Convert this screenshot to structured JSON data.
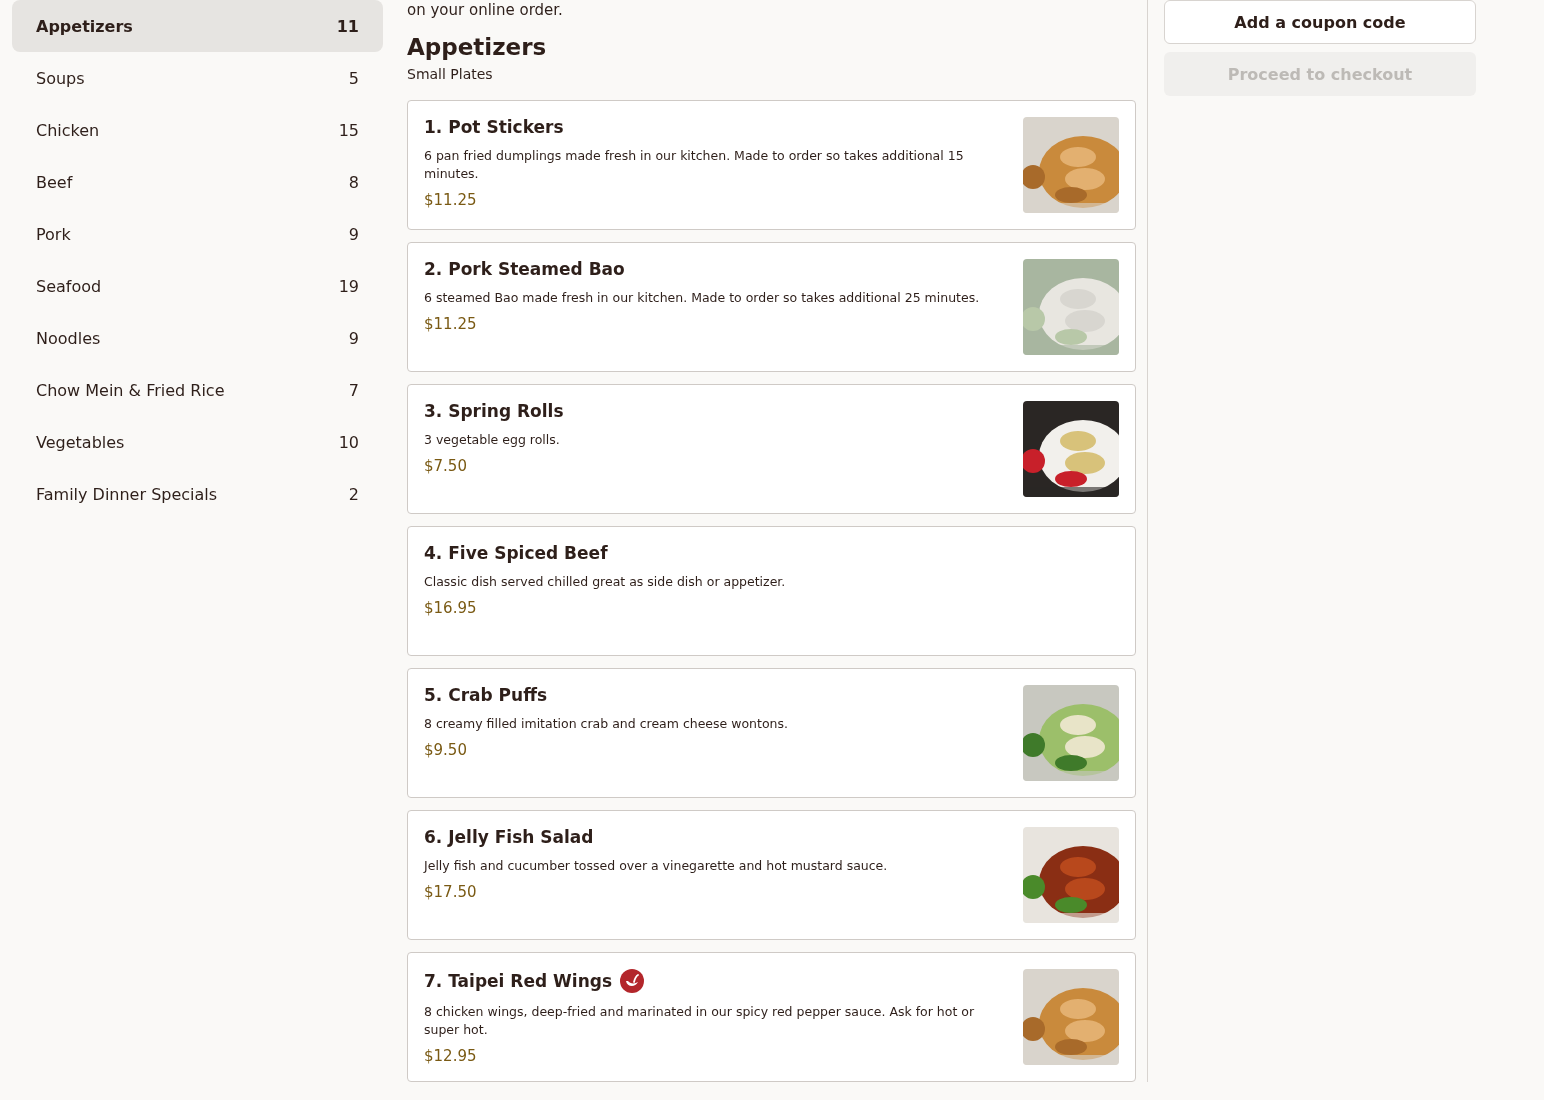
{
  "categories": [
    {
      "name": "Appetizers",
      "count": "11",
      "selected": true
    },
    {
      "name": "Soups",
      "count": "5",
      "selected": false
    },
    {
      "name": "Chicken",
      "count": "15",
      "selected": false
    },
    {
      "name": "Beef",
      "count": "8",
      "selected": false
    },
    {
      "name": "Pork",
      "count": "9",
      "selected": false
    },
    {
      "name": "Seafood",
      "count": "19",
      "selected": false
    },
    {
      "name": "Noodles",
      "count": "9",
      "selected": false
    },
    {
      "name": "Chow Mein & Fried Rice",
      "count": "7",
      "selected": false
    },
    {
      "name": "Vegetables",
      "count": "10",
      "selected": false
    },
    {
      "name": "Family Dinner Specials",
      "count": "2",
      "selected": false
    }
  ],
  "intro_text": "on your online order.",
  "section": {
    "title": "Appetizers",
    "subtitle": "Small Plates"
  },
  "items": [
    {
      "name": "1. Pot Stickers",
      "description": "6 pan fried dumplings made fresh in our kitchen. Made to order so takes additional 15 minutes.",
      "price": "$11.25",
      "spicy": false
    },
    {
      "name": "2. Pork Steamed Bao",
      "description": "6 steamed Bao made fresh in our kitchen. Made to order so takes additional 25 minutes.",
      "price": "$11.25",
      "spicy": false
    },
    {
      "name": "3. Spring Rolls",
      "description": "3 vegetable egg rolls.",
      "price": "$7.50",
      "spicy": false
    },
    {
      "name": "4. Five Spiced Beef",
      "description": "Classic dish served chilled great as side dish or appetizer.",
      "price": "$16.95",
      "spicy": false
    },
    {
      "name": "5. Crab Puffs",
      "description": "8 creamy filled imitation crab and cream cheese wontons.",
      "price": "$9.50",
      "spicy": false
    },
    {
      "name": "6. Jelly Fish Salad",
      "description": "Jelly fish and cucumber tossed over a vinegarette and hot mustard sauce.",
      "price": "$17.50",
      "spicy": false
    },
    {
      "name": "7. Taipei Red Wings",
      "description": "8 chicken wings, deep-fried and marinated in our spicy red pepper sauce. Ask for hot or super hot.",
      "price": "$12.95",
      "spicy": true
    }
  ],
  "cart": {
    "coupon_button": "Add a coupon code",
    "checkout_button": "Proceed to checkout",
    "checkout_disabled": true
  }
}
